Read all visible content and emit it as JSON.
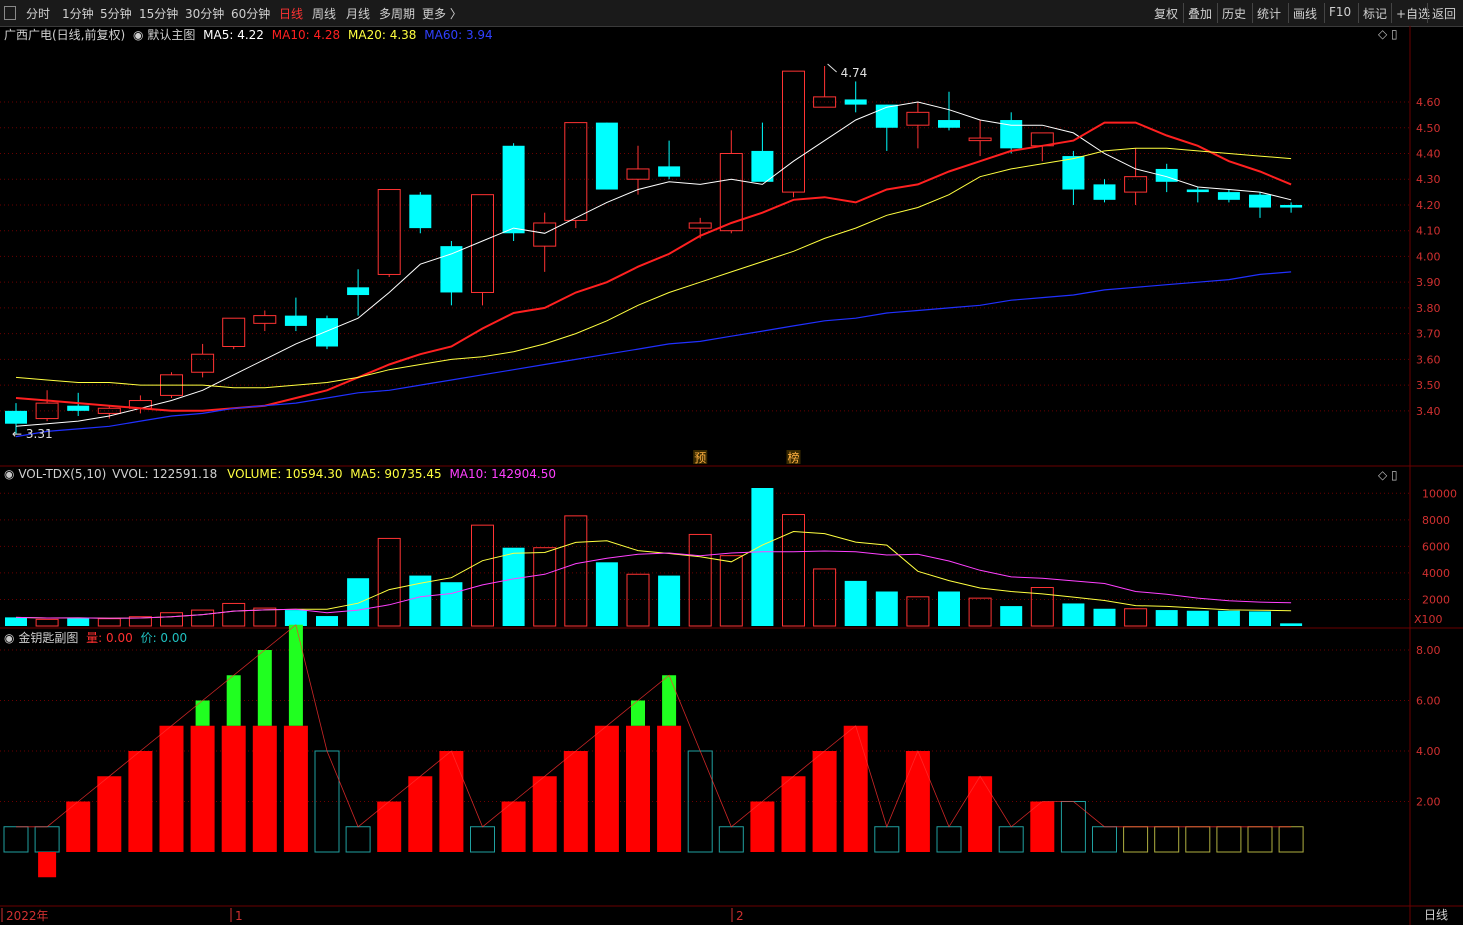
{
  "toolbar": {
    "left_items": [
      "分时",
      "1分钟",
      "5分钟",
      "15分钟",
      "30分钟",
      "60分钟",
      "日线",
      "周线",
      "月线",
      "多周期",
      "更多 〉"
    ],
    "active": "日线",
    "right_items": [
      "复权",
      "叠加",
      "历史",
      "统计",
      "画线",
      "F10",
      "标记",
      "+自选",
      "返回"
    ]
  },
  "main_header": {
    "stock": "广西广电(日线,前复权)",
    "template": "默认主图",
    "ma5": "MA5: 4.22",
    "ma10": "MA10: 4.28",
    "ma20": "MA20: 4.38",
    "ma60": "MA60: 3.94"
  },
  "vol_header": {
    "name": "VOL-TDX(5,10)",
    "vvol": "VVOL: 122591.18",
    "volume": "VOLUME: 10594.30",
    "ma5": "MA5: 90735.45",
    "ma10": "MA10: 142904.50"
  },
  "sub_header": {
    "name": "金钥匙副图",
    "liang": "量: 0.00",
    "jia": "价: 0.00"
  },
  "colors": {
    "up": "#ff3333",
    "down": "#00ffff",
    "ma5": "#ffffff",
    "ma10": "#ff2020",
    "ma20": "#ffff40",
    "ma60": "#2030ff",
    "vol_ma10": "#ff40ff",
    "grid": "#6a0000"
  },
  "markers": {
    "max_label": "4.74",
    "min_label": "3.31",
    "yu": "预",
    "bang": "榜",
    "x100": "X100"
  },
  "x_axis": {
    "labels": [
      "2022年",
      "1",
      "2"
    ],
    "period": "日线"
  },
  "chart_data": [
    {
      "type": "candlestick",
      "ylim": [
        3.31,
        4.74
      ],
      "yticks": [
        3.4,
        3.5,
        3.6,
        3.7,
        3.8,
        3.9,
        4.0,
        4.1,
        4.2,
        4.3,
        4.4,
        4.5,
        4.6
      ],
      "candles": [
        {
          "o": 3.4,
          "h": 3.43,
          "l": 3.31,
          "c": 3.35
        },
        {
          "o": 3.37,
          "h": 3.48,
          "l": 3.36,
          "c": 3.43
        },
        {
          "o": 3.42,
          "h": 3.47,
          "l": 3.38,
          "c": 3.4
        },
        {
          "o": 3.39,
          "h": 3.42,
          "l": 3.37,
          "c": 3.41
        },
        {
          "o": 3.41,
          "h": 3.46,
          "l": 3.39,
          "c": 3.44
        },
        {
          "o": 3.46,
          "h": 3.55,
          "l": 3.45,
          "c": 3.54
        },
        {
          "o": 3.55,
          "h": 3.66,
          "l": 3.53,
          "c": 3.62
        },
        {
          "o": 3.65,
          "h": 3.76,
          "l": 3.64,
          "c": 3.76
        },
        {
          "o": 3.74,
          "h": 3.79,
          "l": 3.71,
          "c": 3.77
        },
        {
          "o": 3.77,
          "h": 3.84,
          "l": 3.71,
          "c": 3.73
        },
        {
          "o": 3.76,
          "h": 3.77,
          "l": 3.64,
          "c": 3.65
        },
        {
          "o": 3.88,
          "h": 3.95,
          "l": 3.77,
          "c": 3.85
        },
        {
          "o": 3.93,
          "h": 4.26,
          "l": 3.92,
          "c": 4.26
        },
        {
          "o": 4.24,
          "h": 4.25,
          "l": 4.09,
          "c": 4.11
        },
        {
          "o": 4.04,
          "h": 4.06,
          "l": 3.81,
          "c": 3.86
        },
        {
          "o": 3.86,
          "h": 4.24,
          "l": 3.81,
          "c": 4.24
        },
        {
          "o": 4.43,
          "h": 4.44,
          "l": 4.06,
          "c": 4.09
        },
        {
          "o": 4.04,
          "h": 4.17,
          "l": 3.94,
          "c": 4.13
        },
        {
          "o": 4.14,
          "h": 4.52,
          "l": 4.11,
          "c": 4.52
        },
        {
          "o": 4.52,
          "h": 4.52,
          "l": 4.26,
          "c": 4.26
        },
        {
          "o": 4.3,
          "h": 4.43,
          "l": 4.24,
          "c": 4.34
        },
        {
          "o": 4.35,
          "h": 4.45,
          "l": 4.3,
          "c": 4.31
        },
        {
          "o": 4.11,
          "h": 4.15,
          "l": 4.07,
          "c": 4.13
        },
        {
          "o": 4.1,
          "h": 4.49,
          "l": 4.09,
          "c": 4.4
        },
        {
          "o": 4.41,
          "h": 4.52,
          "l": 4.32,
          "c": 4.29
        },
        {
          "o": 4.25,
          "h": 4.72,
          "l": 4.23,
          "c": 4.72
        },
        {
          "o": 4.58,
          "h": 4.74,
          "l": 4.58,
          "c": 4.62
        },
        {
          "o": 4.61,
          "h": 4.68,
          "l": 4.56,
          "c": 4.59
        },
        {
          "o": 4.59,
          "h": 4.59,
          "l": 4.41,
          "c": 4.5
        },
        {
          "o": 4.51,
          "h": 4.6,
          "l": 4.42,
          "c": 4.56
        },
        {
          "o": 4.53,
          "h": 4.64,
          "l": 4.49,
          "c": 4.5
        },
        {
          "o": 4.45,
          "h": 4.53,
          "l": 4.39,
          "c": 4.46
        },
        {
          "o": 4.53,
          "h": 4.56,
          "l": 4.4,
          "c": 4.42
        },
        {
          "o": 4.43,
          "h": 4.48,
          "l": 4.37,
          "c": 4.48
        },
        {
          "o": 4.39,
          "h": 4.41,
          "l": 4.2,
          "c": 4.26
        },
        {
          "o": 4.28,
          "h": 4.3,
          "l": 4.21,
          "c": 4.22
        },
        {
          "o": 4.25,
          "h": 4.42,
          "l": 4.2,
          "c": 4.31
        },
        {
          "o": 4.34,
          "h": 4.36,
          "l": 4.25,
          "c": 4.29
        },
        {
          "o": 4.26,
          "h": 4.27,
          "l": 4.21,
          "c": 4.25
        },
        {
          "o": 4.25,
          "h": 4.26,
          "l": 4.21,
          "c": 4.22
        },
        {
          "o": 4.24,
          "h": 4.25,
          "l": 4.15,
          "c": 4.19
        },
        {
          "o": 4.2,
          "h": 4.21,
          "l": 4.17,
          "c": 4.19
        }
      ],
      "series": [
        {
          "name": "MA5",
          "values": [
            3.34,
            3.35,
            3.36,
            3.38,
            3.41,
            3.44,
            3.48,
            3.54,
            3.6,
            3.66,
            3.71,
            3.76,
            3.86,
            3.97,
            4.01,
            4.06,
            4.11,
            4.09,
            4.15,
            4.21,
            4.26,
            4.29,
            4.28,
            4.3,
            4.28,
            4.37,
            4.45,
            4.53,
            4.58,
            4.6,
            4.57,
            4.53,
            4.51,
            4.51,
            4.48,
            4.4,
            4.34,
            4.31,
            4.27,
            4.26,
            4.25,
            4.22
          ]
        },
        {
          "name": "MA10",
          "values": [
            3.45,
            3.44,
            3.43,
            3.42,
            3.41,
            3.4,
            3.4,
            3.41,
            3.42,
            3.45,
            3.48,
            3.53,
            3.58,
            3.62,
            3.65,
            3.72,
            3.78,
            3.8,
            3.86,
            3.9,
            3.96,
            4.01,
            4.08,
            4.13,
            4.17,
            4.22,
            4.23,
            4.21,
            4.26,
            4.28,
            4.33,
            4.37,
            4.41,
            4.43,
            4.45,
            4.52,
            4.52,
            4.47,
            4.43,
            4.37,
            4.33,
            4.28
          ]
        },
        {
          "name": "MA20",
          "values": [
            3.53,
            3.52,
            3.51,
            3.51,
            3.5,
            3.5,
            3.5,
            3.49,
            3.49,
            3.5,
            3.51,
            3.53,
            3.56,
            3.58,
            3.6,
            3.61,
            3.63,
            3.66,
            3.7,
            3.75,
            3.81,
            3.86,
            3.9,
            3.94,
            3.98,
            4.02,
            4.07,
            4.11,
            4.16,
            4.19,
            4.24,
            4.31,
            4.34,
            4.36,
            4.38,
            4.41,
            4.42,
            4.42,
            4.41,
            4.4,
            4.39,
            4.38
          ]
        },
        {
          "name": "MA60",
          "values": [
            3.3,
            3.32,
            3.33,
            3.34,
            3.36,
            3.38,
            3.39,
            3.41,
            3.42,
            3.43,
            3.45,
            3.47,
            3.48,
            3.5,
            3.52,
            3.54,
            3.56,
            3.58,
            3.6,
            3.62,
            3.64,
            3.66,
            3.67,
            3.69,
            3.71,
            3.73,
            3.75,
            3.76,
            3.78,
            3.79,
            3.8,
            3.81,
            3.83,
            3.84,
            3.85,
            3.87,
            3.88,
            3.89,
            3.9,
            3.91,
            3.93,
            3.94
          ]
        }
      ]
    },
    {
      "type": "bar",
      "title": "VOL-TDX(5,10)",
      "ylim": [
        0,
        10400
      ],
      "yticks": [
        2000,
        4000,
        6000,
        8000,
        10000
      ],
      "values": [
        650,
        500,
        600,
        550,
        700,
        1000,
        1200,
        1700,
        1350,
        1200,
        750,
        3600,
        6600,
        3800,
        3300,
        7600,
        5900,
        5900,
        8300,
        4800,
        3900,
        3800,
        6900,
        5300,
        10400,
        8400,
        4300,
        3400,
        2600,
        2200,
        2600,
        2100,
        1500,
        2900,
        1700,
        1300,
        1300,
        1200,
        1150,
        1150,
        1100,
        200
      ],
      "series": [
        {
          "name": "MA5",
          "values": [
            650,
            600,
            610,
            580,
            600,
            700,
            860,
            1120,
            1210,
            1260,
            1260,
            1720,
            2740,
            3220,
            3640,
            4920,
            5480,
            5540,
            6300,
            6420,
            5680,
            5460,
            5220,
            4840,
            6100,
            7120,
            6960,
            6320,
            6100,
            4120,
            3420,
            2860,
            2600,
            2420,
            2180,
            1920,
            1540,
            1480,
            1350,
            1210,
            1190,
            1150
          ]
        },
        {
          "name": "MA10",
          "values": [
            650,
            600,
            610,
            580,
            600,
            700,
            860,
            1120,
            1210,
            1260,
            1000,
            1200,
            1600,
            2200,
            2450,
            3100,
            3550,
            3900,
            4700,
            5100,
            5400,
            5500,
            5300,
            5500,
            5600,
            5600,
            5650,
            5600,
            5350,
            5400,
            4900,
            4200,
            3700,
            3600,
            3400,
            3200,
            2600,
            2400,
            2100,
            1900,
            1800,
            1750
          ]
        }
      ]
    },
    {
      "type": "bar",
      "title": "金钥匙副图",
      "ylim": [
        -1,
        9
      ],
      "yticks": [
        2.0,
        4.0,
        6.0,
        8.0
      ],
      "values": [
        1,
        1,
        2,
        3,
        4,
        5,
        5,
        5,
        5,
        5,
        4,
        1,
        2,
        3,
        4,
        1,
        2,
        3,
        4,
        5,
        5,
        5,
        4,
        1,
        2,
        3,
        4,
        5,
        1,
        4,
        1,
        3,
        1,
        2,
        2,
        1,
        1,
        1,
        1,
        1,
        1,
        1
      ],
      "series": [
        {
          "values": [
            0,
            -1,
            0,
            0,
            0,
            0,
            6,
            7,
            8,
            9,
            0,
            0,
            0,
            0,
            0,
            0,
            0,
            0,
            0,
            0,
            6,
            7,
            0,
            0,
            0,
            0,
            0,
            0,
            0,
            0,
            0,
            0,
            0,
            0,
            0,
            0,
            0,
            0,
            0,
            0,
            0,
            0
          ]
        }
      ]
    }
  ]
}
